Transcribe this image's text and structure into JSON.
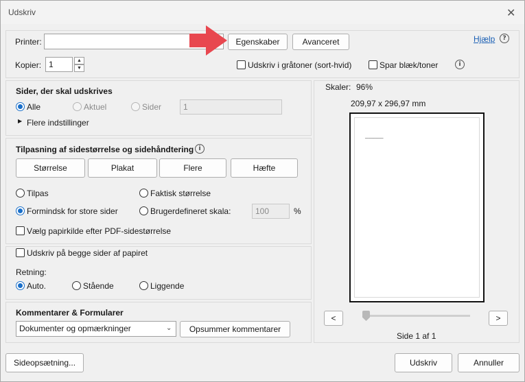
{
  "window": {
    "title": "Udskriv",
    "close_glyph": "✕"
  },
  "printer": {
    "label": "Printer:",
    "value": "",
    "properties_button": "Egenskaber",
    "advanced_button": "Avanceret",
    "help_link": "Hjælp",
    "copies_label": "Kopier:",
    "copies_value": "1",
    "grayscale_label": "Udskriv i gråtoner (sort-hvid)",
    "save_ink_label": "Spar blæk/toner",
    "arrow_color": "#e8474f"
  },
  "pages": {
    "heading": "Sider, der skal udskrives",
    "all": "Alle",
    "current": "Aktuel",
    "pages": "Sider",
    "pages_value": "1",
    "more_settings": "Flere indstillinger"
  },
  "sizing": {
    "heading": "Tilpasning af sidestørrelse og sidehåndtering",
    "tabs": [
      "Størrelse",
      "Plakat",
      "Flere",
      "Hæfte"
    ],
    "fit": "Tilpas",
    "actual_size": "Faktisk størrelse",
    "shrink": "Formindsk for store sider",
    "custom_scale": "Brugerdefineret skala:",
    "scale_value": "100",
    "percent": "%",
    "paper_source": "Vælg papirkilde efter PDF-sidestørrelse"
  },
  "duplex": {
    "both_sides": "Udskriv på begge sider af papiret",
    "orientation_label": "Retning:",
    "auto": "Auto.",
    "portrait": "Stående",
    "landscape": "Liggende"
  },
  "comments": {
    "heading": "Kommentarer & Formularer",
    "select_value": "Dokumenter og opmærkninger",
    "summarize_button": "Opsummer kommentarer"
  },
  "preview": {
    "scale_label": "Skaler:",
    "scale_value": "96%",
    "dimensions": "209,97 x 296,97 mm",
    "page_text": "Side 1 af 1",
    "prev": "<",
    "next": ">"
  },
  "footer": {
    "page_setup": "Sideopsætning...",
    "print": "Udskriv",
    "cancel": "Annuller"
  },
  "accent_color": "#1a6fc9"
}
